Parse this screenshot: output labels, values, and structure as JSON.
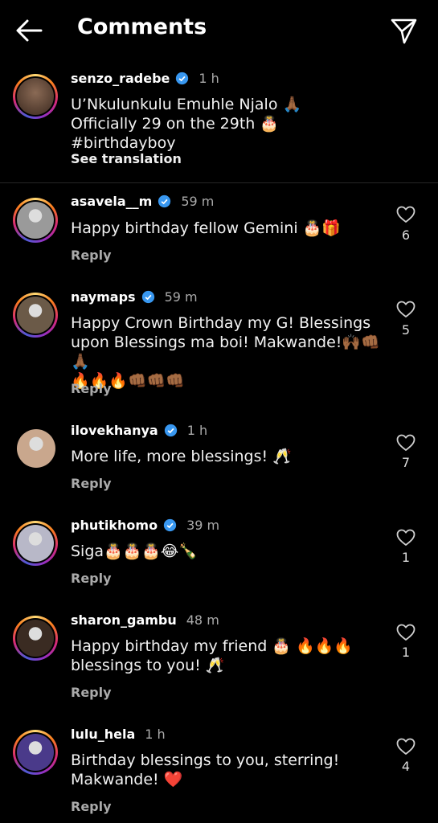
{
  "header": {
    "title": "Comments",
    "back_icon": "back-arrow-icon",
    "send_icon": "send-icon"
  },
  "caption": {
    "username": "senzo_radebe",
    "verified": true,
    "time": "1 h",
    "line1": "U’Nkulunkulu Emuhle Njalo 🙏🏾",
    "line2": "Officially 29 on the 29th 🎂 #birthdayboy",
    "see_translation": "See translation"
  },
  "comments": [
    {
      "username": "asavela__m",
      "verified": true,
      "time": "59 m",
      "lines": [
        "Happy birthday fellow Gemini 🎂🎁"
      ],
      "reply": "Reply",
      "likes": "6",
      "avatar_color": "#9a9a9a"
    },
    {
      "username": "naymaps",
      "verified": true,
      "time": "59 m",
      "lines": [
        "Happy Crown Birthday my G! Blessings",
        "upon Blessings ma boi! Makwande!🙌🏾👊🏾🙏🏾",
        "🔥🔥🔥👊🏾👊🏾👊🏾"
      ],
      "reply": "Reply",
      "likes": "5",
      "avatar_color": "#6b5a48"
    },
    {
      "username": "ilovekhanya",
      "verified": true,
      "time": "1 h",
      "lines": [
        "More life, more blessings! 🥂"
      ],
      "reply": "Reply",
      "likes": "7",
      "avatar_color": "#c9a78d"
    },
    {
      "username": "phutikhomo",
      "verified": true,
      "time": "39 m",
      "lines": [
        "Siga🎂🎂🎂😂🍾"
      ],
      "reply": "Reply",
      "likes": "1",
      "avatar_color": "#b8b8c8"
    },
    {
      "username": "sharon_gambu",
      "verified": false,
      "time": "48 m",
      "lines": [
        "Happy birthday my friend 🎂 🔥🔥🔥",
        "blessings to you! 🥂"
      ],
      "reply": "Reply",
      "likes": "1",
      "avatar_color": "#3a2b22"
    },
    {
      "username": "lulu_hela",
      "verified": false,
      "time": "1 h",
      "lines": [
        "Birthday blessings to you, sterring!",
        "Makwande! ❤️"
      ],
      "reply": "Reply",
      "likes": "4",
      "avatar_color": "#4a3a8a"
    }
  ],
  "colors": {
    "background": "#000000",
    "verified_badge": "#3897f0",
    "secondary_text": "#aaaaaa"
  },
  "icons": {
    "like": "heart-outline-icon",
    "verified": "verified-badge-icon"
  }
}
